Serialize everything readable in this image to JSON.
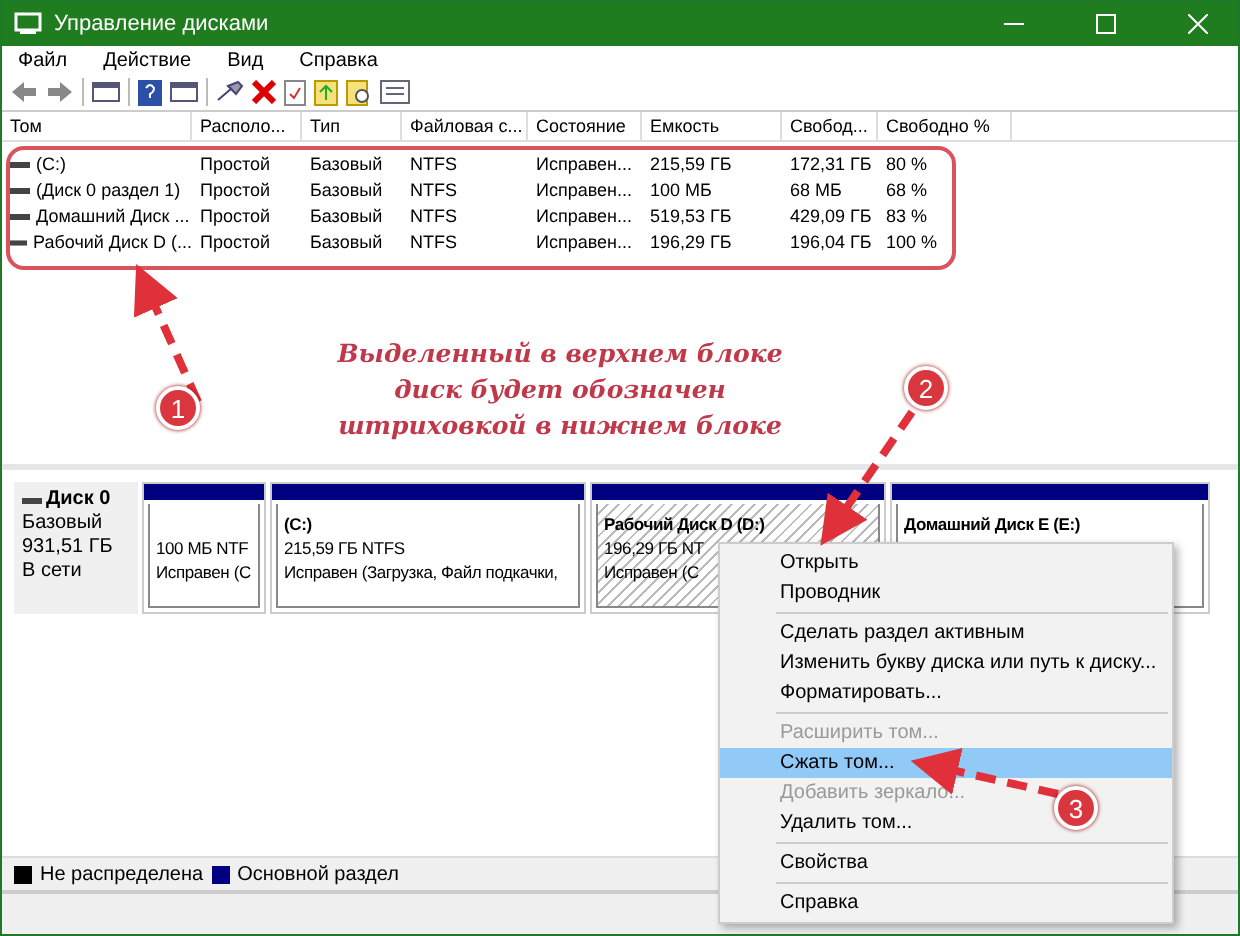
{
  "window": {
    "title": "Управление дисками"
  },
  "menu": [
    "Файл",
    "Действие",
    "Вид",
    "Справка"
  ],
  "table": {
    "columns": [
      "Том",
      "Располо...",
      "Тип",
      "Файловая с...",
      "Состояние",
      "Емкость",
      "Свобод...",
      "Свободно %"
    ],
    "rows": [
      [
        "(C:)",
        "Простой",
        "Базовый",
        "NTFS",
        "Исправен...",
        "215,59 ГБ",
        "172,31 ГБ",
        "80 %"
      ],
      [
        "(Диск 0 раздел 1)",
        "Простой",
        "Базовый",
        "NTFS",
        "Исправен...",
        "100 МБ",
        "68 МБ",
        "68 %"
      ],
      [
        "Домашний Диск ...",
        "Простой",
        "Базовый",
        "NTFS",
        "Исправен...",
        "519,53 ГБ",
        "429,09 ГБ",
        "83 %"
      ],
      [
        "Рабочий Диск D (...",
        "Простой",
        "Базовый",
        "NTFS",
        "Исправен...",
        "196,29 ГБ",
        "196,04 ГБ",
        "100 %"
      ]
    ]
  },
  "annotation": {
    "text": "Выделенный в верхнем блоке\nдиск будет обозначен\nштриховкой в нижнем блоке",
    "markers": [
      "1",
      "2",
      "3"
    ]
  },
  "disk": {
    "name": "Диск 0",
    "type": "Базовый",
    "size": "931,51 ГБ",
    "status": "В сети",
    "partitions": [
      {
        "lines": [
          "100 МБ NTF",
          "Исправен (С"
        ],
        "selected": false
      },
      {
        "title": "(C:)",
        "lines": [
          "215,59 ГБ NTFS",
          "Исправен (Загрузка, Файл подкачки,"
        ],
        "selected": false
      },
      {
        "title": "Рабочий Диск D  (D:)",
        "lines": [
          "196,29 ГБ NT",
          "Исправен (С"
        ],
        "selected": true
      },
      {
        "title": "Домашний Диск E  (E:)",
        "selected": false
      }
    ]
  },
  "context_menu": [
    {
      "kind": "item",
      "label": "Открыть"
    },
    {
      "kind": "item",
      "label": "Проводник"
    },
    {
      "kind": "separator"
    },
    {
      "kind": "item",
      "label": "Сделать раздел активным"
    },
    {
      "kind": "item",
      "label": "Изменить букву диска или путь к диску..."
    },
    {
      "kind": "item",
      "label": "Форматировать..."
    },
    {
      "kind": "separator"
    },
    {
      "kind": "disabled",
      "label": "Расширить том..."
    },
    {
      "kind": "selected",
      "label": "Сжать том..."
    },
    {
      "kind": "disabled",
      "label": "Добавить зеркало..."
    },
    {
      "kind": "item",
      "label": "Удалить том..."
    },
    {
      "kind": "separator"
    },
    {
      "kind": "item",
      "label": "Свойства"
    },
    {
      "kind": "separator"
    },
    {
      "kind": "item",
      "label": "Справка"
    }
  ],
  "legend": [
    {
      "label": "Не распределена",
      "color": "#000000"
    },
    {
      "label": "Основной раздел",
      "color": "#000080"
    }
  ]
}
